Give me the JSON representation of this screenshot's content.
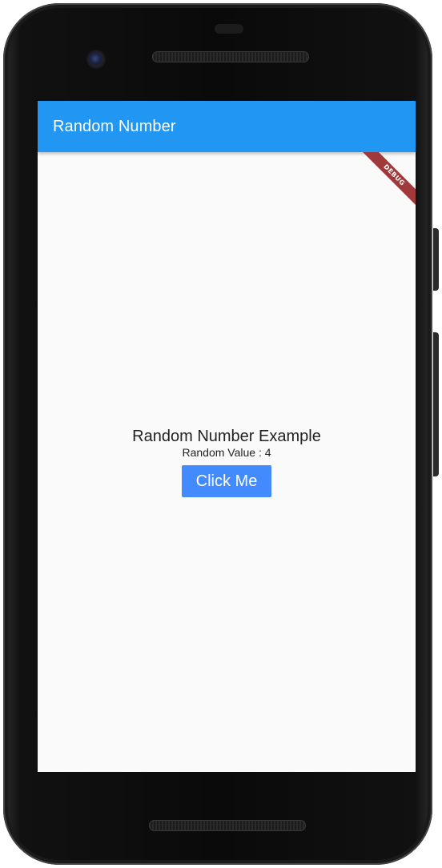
{
  "app_bar": {
    "title": "Random Number"
  },
  "debug_banner": {
    "label": "DEBUG",
    "color": "#a03a3a"
  },
  "content": {
    "heading": "Random Number Example",
    "random_value_text": "Random Value : 4",
    "button_label": "Click Me"
  },
  "colors": {
    "app_bar": "#2196f3",
    "button": "#448aff",
    "background": "#fafafa"
  },
  "icons": [
    "front-camera-icon",
    "earpiece-speaker-icon",
    "bottom-speaker-icon"
  ]
}
